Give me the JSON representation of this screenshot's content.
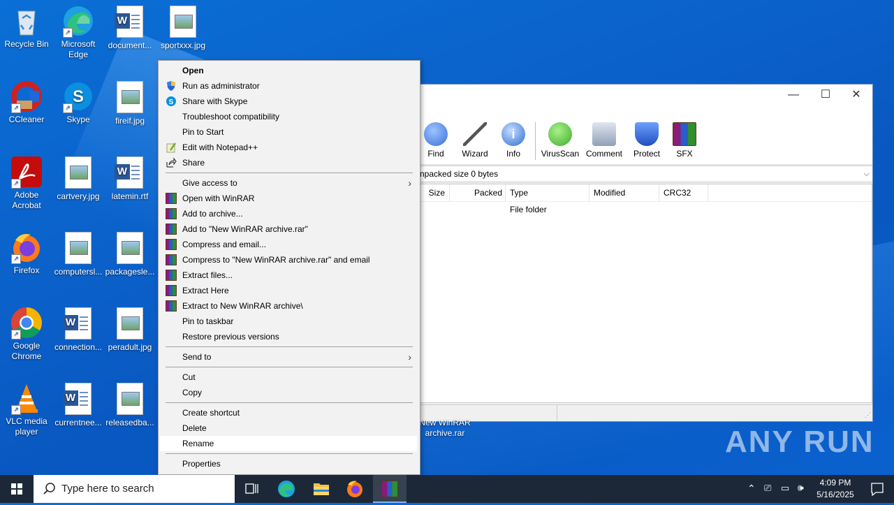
{
  "desktop": {
    "icons": [
      {
        "label": "Recycle Bin"
      },
      {
        "label": "Microsoft Edge"
      },
      {
        "label": "document..."
      },
      {
        "label": "sportxxx.jpg"
      },
      {
        "label": "CCleaner"
      },
      {
        "label": "Skype"
      },
      {
        "label": "fireif.jpg"
      },
      {
        "label": "Adobe Acrobat"
      },
      {
        "label": "cartvery.jpg"
      },
      {
        "label": "latemin.rtf"
      },
      {
        "label": "Firefox"
      },
      {
        "label": "computersl..."
      },
      {
        "label": "packagesle..."
      },
      {
        "label": "Google Chrome"
      },
      {
        "label": "connection..."
      },
      {
        "label": "peradult.jpg"
      },
      {
        "label": "VLC media player"
      },
      {
        "label": "currentnee..."
      },
      {
        "label": "releasedba..."
      }
    ],
    "selected_file_label": "New WinRAR archive.rar",
    "watermark": "ANY RUN"
  },
  "winrar": {
    "toolbar": [
      {
        "label": "Find",
        "color": "#3a6fd8"
      },
      {
        "label": "Wizard",
        "color": "#d8a23a"
      },
      {
        "label": "Info",
        "color": "#2b6fd0"
      },
      {
        "label": "VirusScan",
        "color": "#3fae2a"
      },
      {
        "label": "Comment",
        "color": "#7f8fa8"
      },
      {
        "label": "Protect",
        "color": "#2c62d6"
      },
      {
        "label": "SFX",
        "color": "#c04a8a"
      }
    ],
    "path_text": "npacked size 0 bytes",
    "columns": [
      "Size",
      "Packed",
      "Type",
      "Modified",
      "CRC32"
    ],
    "rows": [
      {
        "type": "File folder"
      }
    ]
  },
  "context_menu": {
    "items": [
      {
        "label": "Open"
      },
      {
        "label": "Run as administrator"
      },
      {
        "label": "Share with Skype"
      },
      {
        "label": "Troubleshoot compatibility"
      },
      {
        "label": "Pin to Start"
      },
      {
        "label": "Edit with Notepad++"
      },
      {
        "label": "Share"
      },
      {
        "label": "Give access to"
      },
      {
        "label": "Open with WinRAR"
      },
      {
        "label": "Add to archive..."
      },
      {
        "label": "Add to \"New WinRAR archive.rar\""
      },
      {
        "label": "Compress and email..."
      },
      {
        "label": "Compress to \"New WinRAR archive.rar\" and email"
      },
      {
        "label": "Extract files..."
      },
      {
        "label": "Extract Here"
      },
      {
        "label": "Extract to New WinRAR archive\\"
      },
      {
        "label": "Pin to taskbar"
      },
      {
        "label": "Restore previous versions"
      },
      {
        "label": "Send to"
      },
      {
        "label": "Cut"
      },
      {
        "label": "Copy"
      },
      {
        "label": "Create shortcut"
      },
      {
        "label": "Delete"
      },
      {
        "label": "Rename"
      },
      {
        "label": "Properties"
      }
    ]
  },
  "taskbar": {
    "search_placeholder": "Type here to search",
    "time": "4:09 PM",
    "date": "5/16/2025"
  }
}
